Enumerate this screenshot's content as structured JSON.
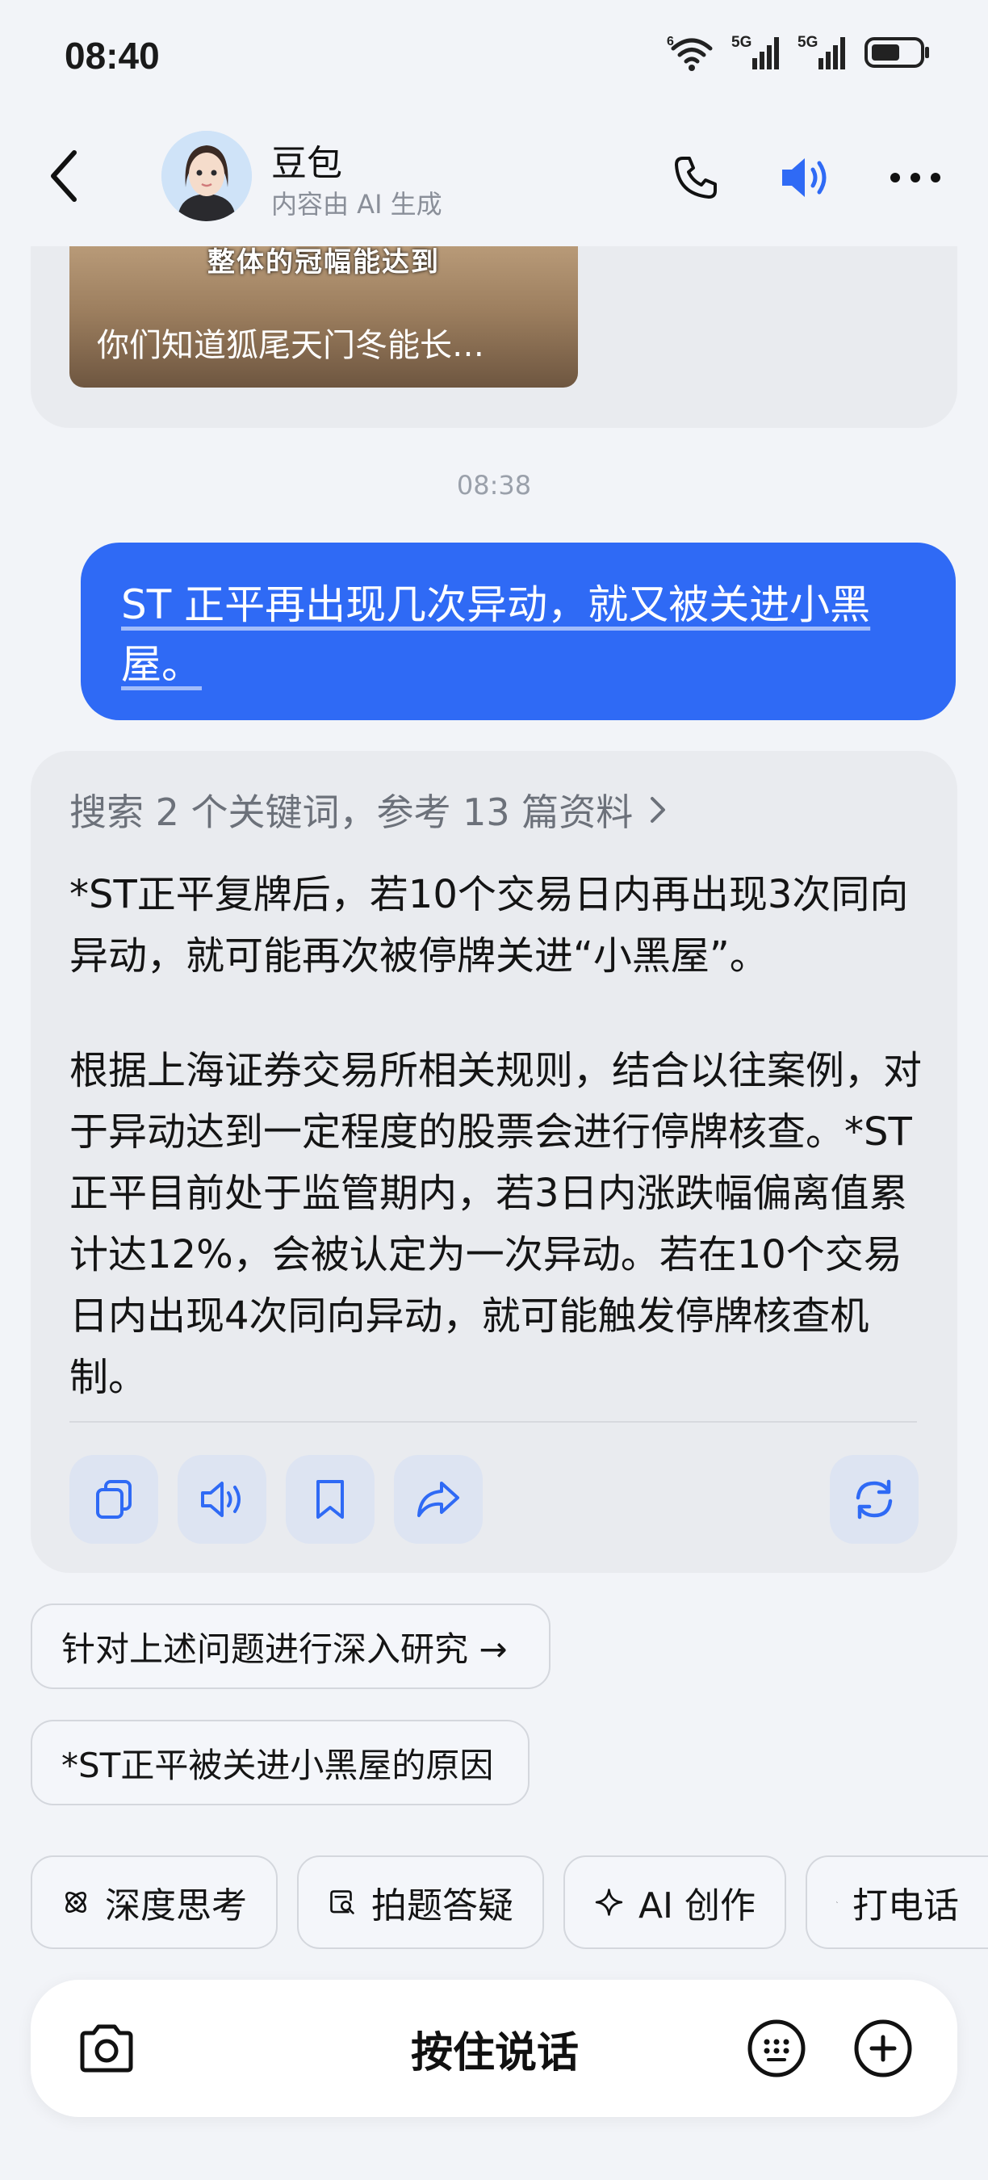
{
  "status_bar": {
    "time": "08:40",
    "network_1": "5G",
    "network_2": "5G",
    "wifi_badge": "6"
  },
  "header": {
    "bot_name": "豆包",
    "subtitle": "内容由 AI 生成",
    "icons": [
      "back-icon",
      "phone-icon",
      "speaker-icon",
      "more-icon"
    ],
    "accent_color": "#2f6af5"
  },
  "previous_card": {
    "thumb_caption_top": "整体的冠幅能达到",
    "thumb_title": "你们知道狐尾天门冬能长…"
  },
  "timestamp": "08:38",
  "user_message": {
    "text": "ST 正平再出现几次异动，就又被关进小黑屋。"
  },
  "answer": {
    "search_summary": "搜索 2 个关键词，参考 13 篇资料",
    "paragraph_1": "*ST正平复牌后，若10个交易日内再出现3次同向异动，就可能再次被停牌关进“小黑屋”。",
    "paragraph_2": "根据上海证券交易所相关规则，结合以往案例，对于异动达到一定程度的股票会进行停牌核查。*ST正平目前处于监管期内，若3日内涨跌幅偏离值累计达12%，会被认定为一次异动。若在10个交易日内出现4次同向异动，就可能触发停牌核查机制。",
    "actions": [
      "copy-icon",
      "read-aloud-icon",
      "bookmark-icon",
      "share-icon",
      "regenerate-icon"
    ]
  },
  "suggestions": [
    "针对上述问题进行深入研究 →",
    "*ST正平被关进小黑屋的原因"
  ],
  "tools": [
    {
      "label": "深度思考",
      "icon": "atom-icon"
    },
    {
      "label": "拍题答疑",
      "icon": "photo-search-icon"
    },
    {
      "label": "AI 创作",
      "icon": "sparkle-icon"
    },
    {
      "label": "打电话",
      "icon": "phone-icon"
    }
  ],
  "input_bar": {
    "hold_to_talk": "按住说话"
  }
}
